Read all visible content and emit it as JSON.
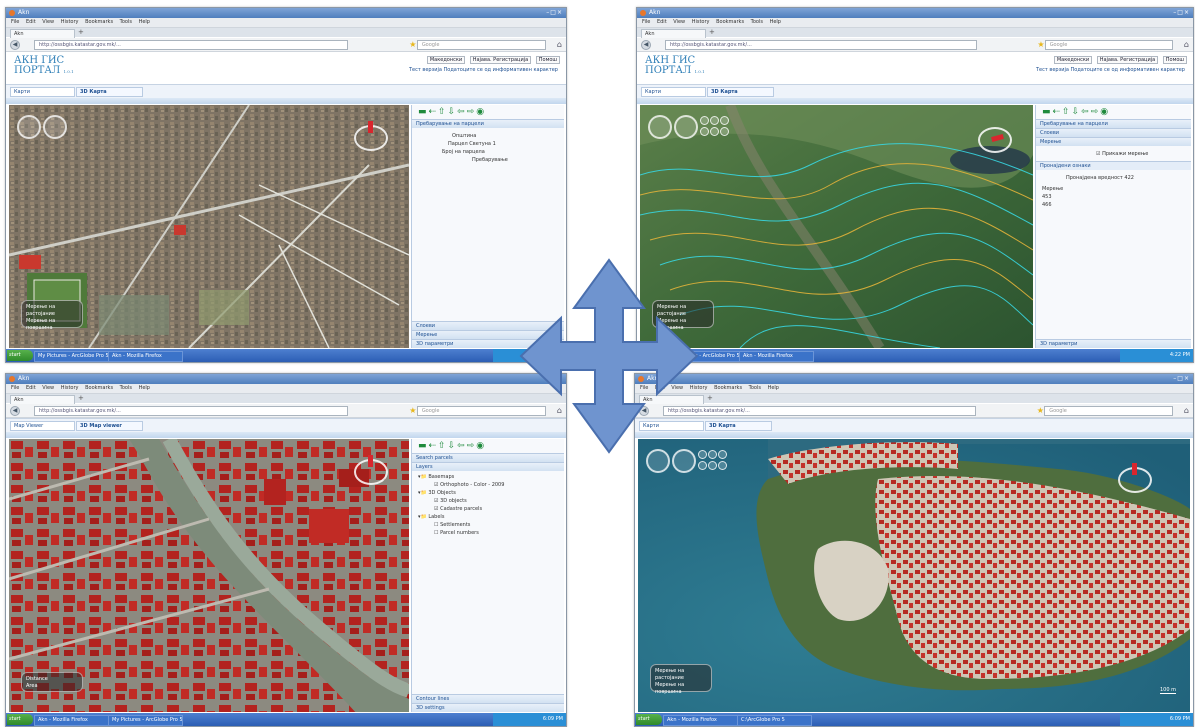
{
  "browser": {
    "menu": [
      "File",
      "Edit",
      "View",
      "History",
      "Bookmarks",
      "Tools",
      "Help"
    ],
    "tab_label": "Akn",
    "url": "http://ossbgis.katastar.gov.mk/...",
    "search_placeholder": "Google"
  },
  "portal": {
    "logo_line1": "АКН ГИС",
    "logo_line2": "ПОРТАЛ",
    "logo_small": "1.0.1",
    "links": [
      "Македонски",
      "Најава. Регистрација",
      "Помош"
    ],
    "subtitle": "Тест верзија Податоците се од информативен карактер",
    "tab_maps": "Карти",
    "tab_3d": "3D Карта"
  },
  "windows": [
    {
      "id": "top-left",
      "tab_left": "Карти",
      "tab_right": "3D Карта",
      "panel_section": "Пребарување на парцели",
      "panel_fields": [
        "Општина",
        "Парцел Светуна 1",
        "Број на парцела",
        "Пребарување"
      ],
      "panel_bottom": [
        "Слоеви",
        "Мерење",
        "3D параметри"
      ],
      "osd": [
        "Мерење на",
        "растојание",
        "Мерење на површина"
      ],
      "taskbar": [
        "start",
        "My Pictures - ArcGlobe Pro 5",
        "Akn - Mozilla Firefox"
      ]
    },
    {
      "id": "top-right",
      "tab_left": "Карти",
      "tab_right": "3D Карта",
      "panel_sections": [
        "Пребарување на парцели",
        "Слоеви",
        "Мерење"
      ],
      "panel_check": "Прикажи мерење",
      "panel_sub": "Пронајдени ознаки",
      "panel_values": [
        "Пронајдена вредност",
        "422",
        "Мерење",
        "453",
        "466"
      ],
      "panel_bottom": [
        "3D параметри"
      ],
      "osd": [
        "Мерење на",
        "растојание",
        "Мерење на површина"
      ],
      "taskbar": [
        "start",
        "My Pictures - ArcGlobe Pro 5",
        "Akn - Mozilla Firefox"
      ],
      "clock": "4:22 PM"
    },
    {
      "id": "bottom-left",
      "tab_left": "Map Viewer",
      "tab_right": "3D Map viewer",
      "panel_sections": [
        "Search parcels",
        "Layers"
      ],
      "panel_layers": [
        "Basemaps",
        "Orthophoto - Color - 2009",
        "3D Objects",
        "3D objects",
        "Cadastre parcels",
        "Labels",
        "Settlements",
        "Parcel numbers"
      ],
      "panel_bottom": [
        "Contour lines",
        "3D settings"
      ],
      "osd": [
        "Distance",
        "Area"
      ],
      "taskbar": [
        "start",
        "Akn - Mozilla Firefox",
        "My Pictures - ArcGlobe Pro 5"
      ],
      "clock": "6:09 PM"
    },
    {
      "id": "bottom-right",
      "tab_left": "Карти",
      "tab_right": "3D Карта",
      "osd": [
        "Мерење на",
        "растојание",
        "Мерење на површина"
      ],
      "scale": "100 m",
      "taskbar": [
        "start",
        "Akn - Mozilla Firefox",
        "C:\\ArcGlobe Pro 5"
      ],
      "clock": "6:09 PM"
    }
  ]
}
